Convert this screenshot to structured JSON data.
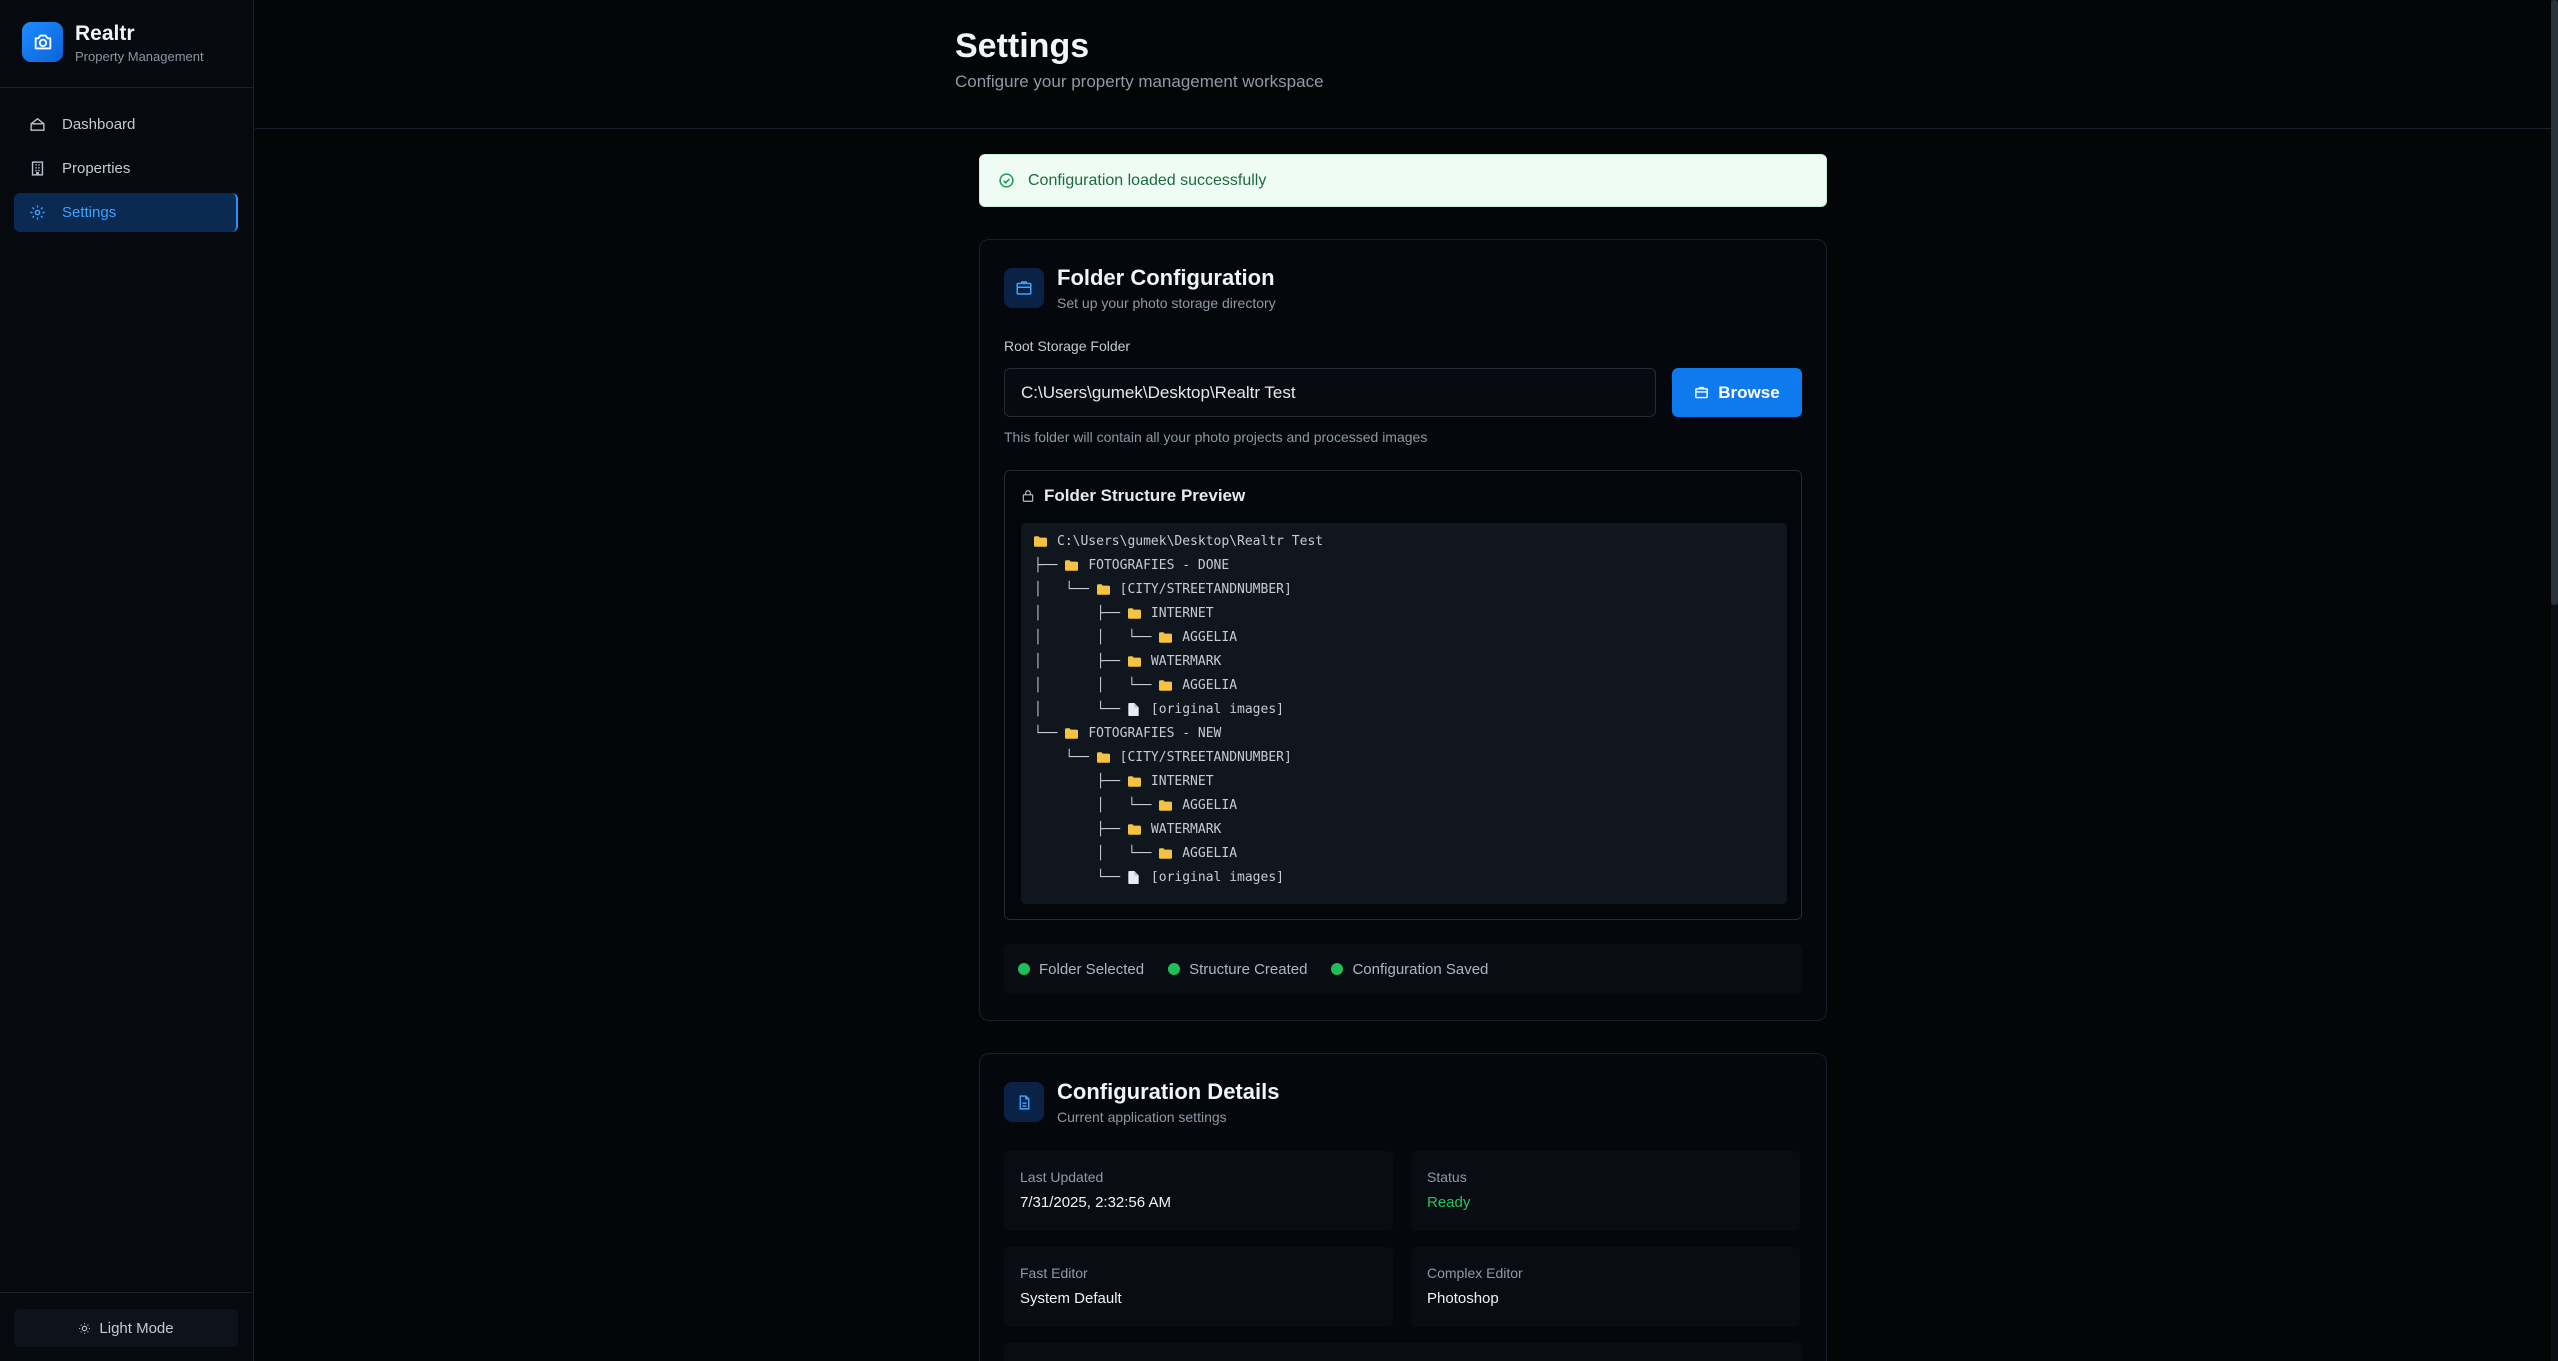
{
  "brand": {
    "name": "Realtr",
    "subtitle": "Property Management",
    "logo_icon": "camera-icon"
  },
  "sidebar": {
    "items": [
      {
        "label": "Dashboard",
        "icon": "dashboard-icon",
        "active": false
      },
      {
        "label": "Properties",
        "icon": "building-icon",
        "active": true
      },
      {
        "label": "Settings",
        "icon": "gear-icon",
        "active": true
      }
    ],
    "theme_toggle": "Light Mode"
  },
  "header": {
    "title": "Settings",
    "subtitle": "Configure your property management workspace"
  },
  "toast": {
    "message": "Configuration loaded successfully",
    "color": "#1c6b3f"
  },
  "folder_card": {
    "title": "Folder Configuration",
    "subtitle": "Set up your photo storage directory",
    "field_label": "Root Storage Folder",
    "path_value": "C:\\Users\\gumek\\Desktop\\Realtr Test",
    "browse_label": "Browse",
    "help_text": "This folder will contain all your photo projects and processed images",
    "preview_title": "Folder Structure Preview",
    "tree": [
      {
        "prefix": "",
        "type": "folder",
        "name": "C:\\Users\\gumek\\Desktop\\Realtr Test"
      },
      {
        "prefix": "├── ",
        "type": "folder",
        "name": "FOTOGRAFIES - DONE"
      },
      {
        "prefix": "│   └── ",
        "type": "folder",
        "name": "[CITY/STREETANDNUMBER]"
      },
      {
        "prefix": "│       ├── ",
        "type": "folder",
        "name": "INTERNET"
      },
      {
        "prefix": "│       │   └── ",
        "type": "folder",
        "name": "AGGELIA"
      },
      {
        "prefix": "│       ├── ",
        "type": "folder",
        "name": "WATERMARK"
      },
      {
        "prefix": "│       │   └── ",
        "type": "folder",
        "name": "AGGELIA"
      },
      {
        "prefix": "│       └── ",
        "type": "file",
        "name": "[original images]"
      },
      {
        "prefix": "└── ",
        "type": "folder",
        "name": "FOTOGRAFIES - NEW"
      },
      {
        "prefix": "    └── ",
        "type": "folder",
        "name": "[CITY/STREETANDNUMBER]"
      },
      {
        "prefix": "        ├── ",
        "type": "folder",
        "name": "INTERNET"
      },
      {
        "prefix": "        │   └── ",
        "type": "folder",
        "name": "AGGELIA"
      },
      {
        "prefix": "        ├── ",
        "type": "folder",
        "name": "WATERMARK"
      },
      {
        "prefix": "        │   └── ",
        "type": "folder",
        "name": "AGGELIA"
      },
      {
        "prefix": "        └── ",
        "type": "file",
        "name": "[original images]"
      }
    ],
    "statuses": [
      {
        "label": "Folder Selected",
        "color": "#1fbe5a"
      },
      {
        "label": "Structure Created",
        "color": "#1fbe5a"
      },
      {
        "label": "Configuration Saved",
        "color": "#1fbe5a"
      }
    ]
  },
  "config_card": {
    "title": "Configuration Details",
    "subtitle": "Current application settings",
    "details": [
      {
        "label": "Last Updated",
        "value": "7/31/2025, 2:32:56 AM"
      },
      {
        "label": "Status",
        "value": "Ready",
        "color": "#22c55e"
      },
      {
        "label": "Fast Editor",
        "value": "System Default"
      },
      {
        "label": "Complex Editor",
        "value": "Photoshop"
      }
    ]
  },
  "colors": {
    "accent": "#0e7af0",
    "background": "#030507",
    "success": "#1fbe5a"
  }
}
